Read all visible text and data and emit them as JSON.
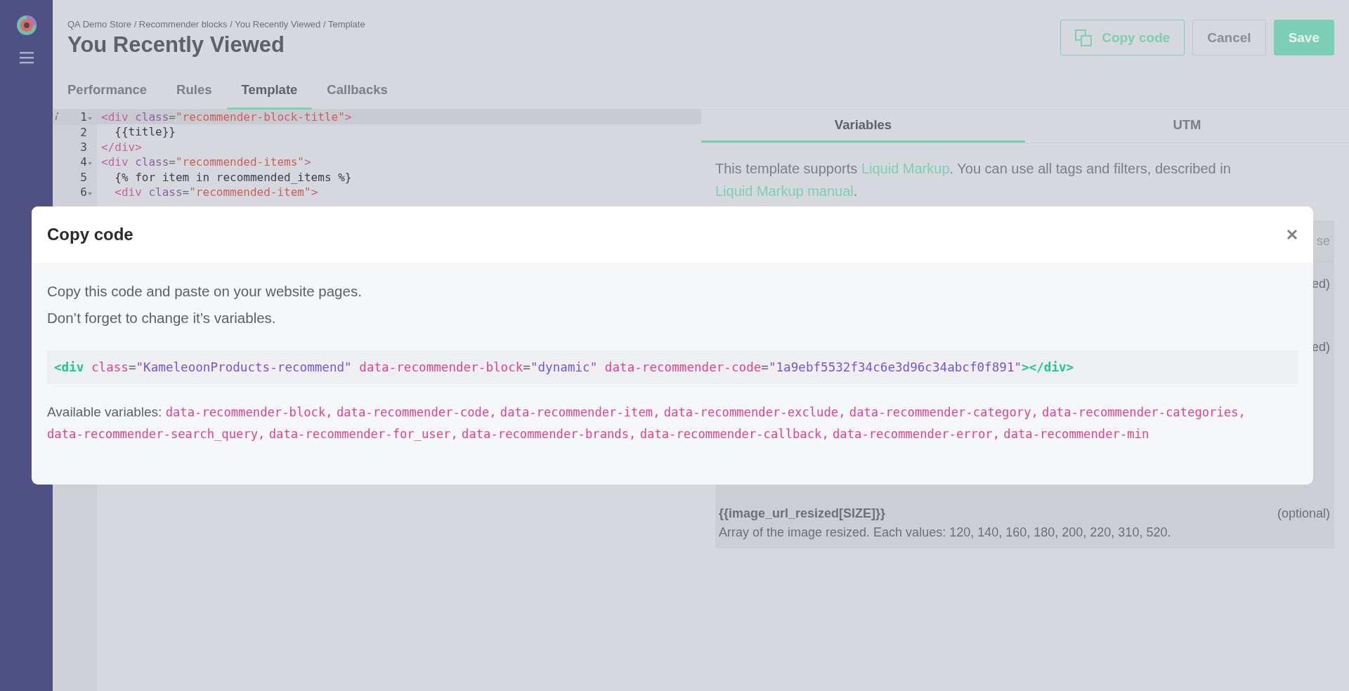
{
  "breadcrumb": "QA Demo Store / Recommender blocks / You Recently Viewed / Template",
  "title": "You Recently Viewed",
  "buttons": [
    {
      "label": "Copy code",
      "kind": "outline"
    },
    {
      "label": "Cancel",
      "kind": "default"
    },
    {
      "label": "Save",
      "kind": "primary"
    }
  ],
  "tabs": [
    {
      "label": "Performance",
      "selected": false
    },
    {
      "label": "Rules",
      "selected": false
    },
    {
      "label": "Template",
      "selected": true
    },
    {
      "label": "Callbacks",
      "selected": false
    }
  ],
  "editor": {
    "lines": [
      {
        "number": "1",
        "fold": true,
        "active": true,
        "tokens": [
          {
            "kind": "tag",
            "text": "<div"
          },
          {
            "kind": "attr",
            "text": " class"
          },
          {
            "kind": "punct",
            "text": "="
          },
          {
            "kind": "str",
            "text": "\"recommender-block-title\""
          },
          {
            "kind": "tag",
            "text": ">"
          }
        ]
      },
      {
        "number": "2",
        "fold": false,
        "active": false,
        "tokens": [
          {
            "kind": "text",
            "text": "  {{title}}"
          }
        ]
      },
      {
        "number": "3",
        "fold": false,
        "active": false,
        "tokens": [
          {
            "kind": "tag",
            "text": "</div>"
          }
        ]
      },
      {
        "number": "4",
        "fold": true,
        "active": false,
        "tokens": [
          {
            "kind": "tag",
            "text": "<div"
          },
          {
            "kind": "attr",
            "text": " class"
          },
          {
            "kind": "punct",
            "text": "="
          },
          {
            "kind": "str",
            "text": "\"recommended-items\""
          },
          {
            "kind": "tag",
            "text": ">"
          }
        ]
      },
      {
        "number": "5",
        "fold": false,
        "active": false,
        "tokens": [
          {
            "kind": "text",
            "text": "  {% for item in recommended_items %}"
          }
        ]
      },
      {
        "number": "6",
        "fold": true,
        "active": false,
        "tokens": [
          {
            "kind": "tag",
            "text": "  <div"
          },
          {
            "kind": "attr",
            "text": " class"
          },
          {
            "kind": "punct",
            "text": "="
          },
          {
            "kind": "str",
            "text": "\"recommended-item\""
          },
          {
            "kind": "tag",
            "text": ">"
          }
        ]
      }
    ]
  },
  "side_tabs": [
    {
      "label": "Variables",
      "selected": true
    },
    {
      "label": "UTM",
      "selected": false
    }
  ],
  "intro": [
    {
      "text": "This template supports ",
      "link": false
    },
    {
      "text": "Liquid Markup",
      "link": true
    },
    {
      "text": ". You can use all tags and filters, described in ",
      "link": false
    },
    {
      "text": "Liquid Markup manual",
      "link": true
    },
    {
      "text": ".",
      "link": false
    }
  ],
  "variables": [
    {
      "kind": "fragment",
      "text": "se"
    },
    {
      "kind": "fragment",
      "text": "ed)"
    },
    {
      "kind": "fragment",
      "text": "ed)"
    },
    {
      "kind": "variable",
      "name": "{{image_url_resized[SIZE]}}",
      "note": "(optional)",
      "description": "Array of the image resized. Each values: 120, 140, 160, 180, 200, 220, 310, 520."
    }
  ],
  "modal": {
    "title": "Copy code",
    "lines": [
      "Copy this code and paste on your website pages.",
      "Don’t forget to change it’s variables."
    ],
    "snippet": [
      {
        "kind": "tag",
        "text": "<div"
      },
      {
        "kind": "attr",
        "text": " class"
      },
      {
        "kind": "punct",
        "text": "="
      },
      {
        "kind": "str",
        "text": "\"KameleoonProducts-recommend\""
      },
      {
        "kind": "attr",
        "text": " data-recommender-block"
      },
      {
        "kind": "punct",
        "text": "="
      },
      {
        "kind": "str",
        "text": "\"dynamic\""
      },
      {
        "kind": "attr",
        "text": " data-recommender-code"
      },
      {
        "kind": "punct",
        "text": "="
      },
      {
        "kind": "str",
        "text": "\"1a9ebf5532f34c6e3d96c34abcf0f891\""
      },
      {
        "kind": "tag",
        "text": "></div>"
      }
    ],
    "variables_label": "Available variables:",
    "variables": [
      "data-recommender-block,",
      "data-recommender-code,",
      "data-recommender-item,",
      "data-recommender-exclude,",
      "data-recommender-category,",
      "data-recommender-categories,",
      "data-recommender-search_query,",
      "data-recommender-for_user,",
      "data-recommender-brands,",
      "data-recommender-callback,",
      "data-recommender-error,",
      "data-recommender-min"
    ]
  }
}
